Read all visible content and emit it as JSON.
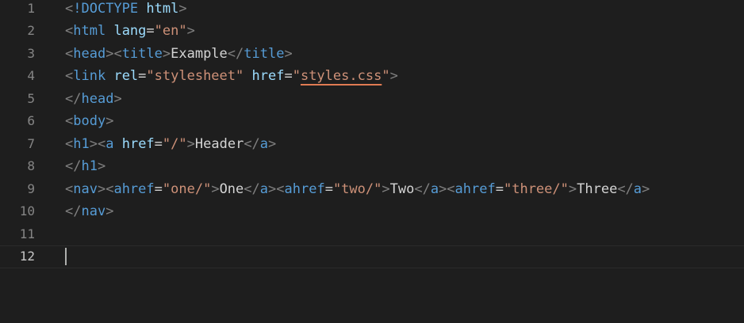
{
  "colors": {
    "background": "#1e1e1e",
    "line_number": "#858585",
    "line_number_active": "#c6c6c6",
    "punctuation": "#808080",
    "tag": "#569cd6",
    "attribute": "#9cdcfe",
    "string": "#ce9178",
    "text": "#d4d4d4",
    "squiggle": "#e07b53"
  },
  "editor": {
    "active_line": 12,
    "lines": [
      {
        "number": "1",
        "tokens": [
          {
            "t": "punct",
            "v": "<"
          },
          {
            "t": "tag",
            "v": "!DOCTYPE"
          },
          {
            "t": "text",
            "v": " "
          },
          {
            "t": "attr",
            "v": "html"
          },
          {
            "t": "punct",
            "v": ">"
          }
        ]
      },
      {
        "number": "2",
        "tokens": [
          {
            "t": "punct",
            "v": "<"
          },
          {
            "t": "tag",
            "v": "html"
          },
          {
            "t": "text",
            "v": " "
          },
          {
            "t": "attr",
            "v": "lang"
          },
          {
            "t": "eq",
            "v": "="
          },
          {
            "t": "str",
            "v": "\"en\""
          },
          {
            "t": "punct",
            "v": ">"
          }
        ]
      },
      {
        "number": "3",
        "tokens": [
          {
            "t": "punct",
            "v": "<"
          },
          {
            "t": "tag",
            "v": "head"
          },
          {
            "t": "punct",
            "v": "><"
          },
          {
            "t": "tag",
            "v": "title"
          },
          {
            "t": "punct",
            "v": ">"
          },
          {
            "t": "text",
            "v": "Example"
          },
          {
            "t": "punct",
            "v": "</"
          },
          {
            "t": "tag",
            "v": "title"
          },
          {
            "t": "punct",
            "v": ">"
          }
        ]
      },
      {
        "number": "4",
        "tokens": [
          {
            "t": "punct",
            "v": "<"
          },
          {
            "t": "tag",
            "v": "link"
          },
          {
            "t": "text",
            "v": " "
          },
          {
            "t": "attr",
            "v": "rel"
          },
          {
            "t": "eq",
            "v": "="
          },
          {
            "t": "str",
            "v": "\"stylesheet\""
          },
          {
            "t": "text",
            "v": " "
          },
          {
            "t": "attr",
            "v": "href"
          },
          {
            "t": "eq",
            "v": "="
          },
          {
            "t": "str",
            "v": "\""
          },
          {
            "t": "str-squiggle",
            "v": "styles.css"
          },
          {
            "t": "str",
            "v": "\""
          },
          {
            "t": "punct",
            "v": ">"
          }
        ]
      },
      {
        "number": "5",
        "tokens": [
          {
            "t": "punct",
            "v": "</"
          },
          {
            "t": "tag",
            "v": "head"
          },
          {
            "t": "punct",
            "v": ">"
          }
        ]
      },
      {
        "number": "6",
        "tokens": [
          {
            "t": "punct",
            "v": "<"
          },
          {
            "t": "tag",
            "v": "body"
          },
          {
            "t": "punct",
            "v": ">"
          }
        ]
      },
      {
        "number": "7",
        "tokens": [
          {
            "t": "punct",
            "v": "<"
          },
          {
            "t": "tag",
            "v": "h1"
          },
          {
            "t": "punct",
            "v": "><"
          },
          {
            "t": "tag",
            "v": "a"
          },
          {
            "t": "text",
            "v": " "
          },
          {
            "t": "attr",
            "v": "href"
          },
          {
            "t": "eq",
            "v": "="
          },
          {
            "t": "str",
            "v": "\"/\""
          },
          {
            "t": "punct",
            "v": ">"
          },
          {
            "t": "text",
            "v": "Header"
          },
          {
            "t": "punct",
            "v": "</"
          },
          {
            "t": "tag",
            "v": "a"
          },
          {
            "t": "punct",
            "v": ">"
          }
        ]
      },
      {
        "number": "8",
        "tokens": [
          {
            "t": "punct",
            "v": "</"
          },
          {
            "t": "tag",
            "v": "h1"
          },
          {
            "t": "punct",
            "v": ">"
          }
        ]
      },
      {
        "number": "9",
        "tokens": [
          {
            "t": "punct",
            "v": "<"
          },
          {
            "t": "tag",
            "v": "nav"
          },
          {
            "t": "punct",
            "v": "><"
          },
          {
            "t": "tag",
            "v": "ahref"
          },
          {
            "t": "eq",
            "v": "="
          },
          {
            "t": "str",
            "v": "\"one/\""
          },
          {
            "t": "punct",
            "v": ">"
          },
          {
            "t": "text",
            "v": "One"
          },
          {
            "t": "punct",
            "v": "</"
          },
          {
            "t": "tag",
            "v": "a"
          },
          {
            "t": "punct",
            "v": "><"
          },
          {
            "t": "tag",
            "v": "ahref"
          },
          {
            "t": "eq",
            "v": "="
          },
          {
            "t": "str",
            "v": "\"two/\""
          },
          {
            "t": "punct",
            "v": ">"
          },
          {
            "t": "text",
            "v": "Two"
          },
          {
            "t": "punct",
            "v": "</"
          },
          {
            "t": "tag",
            "v": "a"
          },
          {
            "t": "punct",
            "v": "><"
          },
          {
            "t": "tag",
            "v": "ahref"
          },
          {
            "t": "eq",
            "v": "="
          },
          {
            "t": "str",
            "v": "\"three/\""
          },
          {
            "t": "punct",
            "v": ">"
          },
          {
            "t": "text",
            "v": "Three"
          },
          {
            "t": "punct",
            "v": "</"
          },
          {
            "t": "tag",
            "v": "a"
          },
          {
            "t": "punct",
            "v": ">"
          }
        ]
      },
      {
        "number": "10",
        "tokens": [
          {
            "t": "punct",
            "v": "</"
          },
          {
            "t": "tag",
            "v": "nav"
          },
          {
            "t": "punct",
            "v": ">"
          }
        ]
      },
      {
        "number": "11",
        "tokens": []
      },
      {
        "number": "12",
        "tokens": []
      }
    ]
  }
}
